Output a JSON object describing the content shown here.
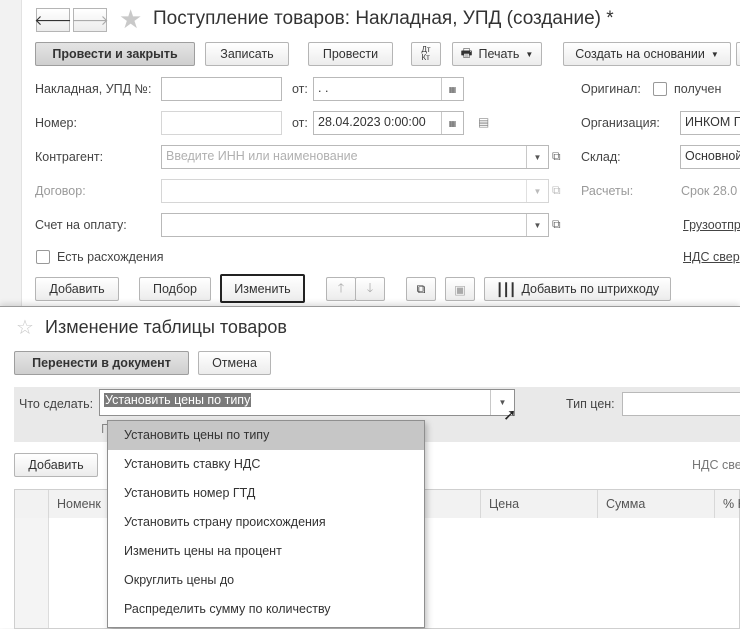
{
  "doc": {
    "title": "Поступление товаров: Накладная, УПД (создание) *",
    "toolbar": {
      "post_close": "Провести и закрыть",
      "save": "Записать",
      "post": "Провести",
      "dt_kt": "Дт\nКт",
      "print": "Печать",
      "create_based": "Создать на основании"
    },
    "fields": {
      "invoice_no_label": "Накладная, УПД №:",
      "from_label": "от:",
      "invoice_date": " .  .",
      "number_label": "Номер:",
      "number_date": "28.04.2023  0:00:00",
      "contractor_label": "Контрагент:",
      "contractor_placeholder": "Введите ИНН или наименование",
      "contract_label": "Договор:",
      "payment_invoice_label": "Счет на оплату:",
      "discrepancy_label": "Есть расхождения",
      "original_label": "Оригинал:",
      "original_received": "получен",
      "organization_label": "Организация:",
      "organization_value": "ИНКОМ Г",
      "warehouse_label": "Склад:",
      "warehouse_value": "Основной",
      "settlements_label": "Расчеты:",
      "settlements_value": "Срок 28.0",
      "shipper_link": "Грузоотпр",
      "vat_link": "НДС свер"
    },
    "table_toolbar": {
      "add": "Добавить",
      "select": "Подбор",
      "change": "Изменить",
      "add_barcode": "Добавить по штрихкоду"
    }
  },
  "modal": {
    "title": "Изменение таблицы товаров",
    "transfer": "Перенести в документ",
    "cancel": "Отмена",
    "action_label": "Что сделать:",
    "action_value": "Установить цены по типу",
    "price_type_label": "Тип цен:",
    "add": "Добавить",
    "vat_partial": "НДС све",
    "under_letter": "Г",
    "columns": [
      "Номенк",
      "Цена",
      "Сумма",
      "% Н"
    ],
    "options": [
      "Установить цены по типу",
      "Установить ставку НДС",
      "Установить номер ГТД",
      "Установить страну происхождения",
      "Изменить цены на процент",
      "Округлить цены до",
      "Распределить сумму по количеству"
    ]
  },
  "colors": {
    "selected_option": "#c6c6c6",
    "primary_button": "#d6d6d6"
  }
}
